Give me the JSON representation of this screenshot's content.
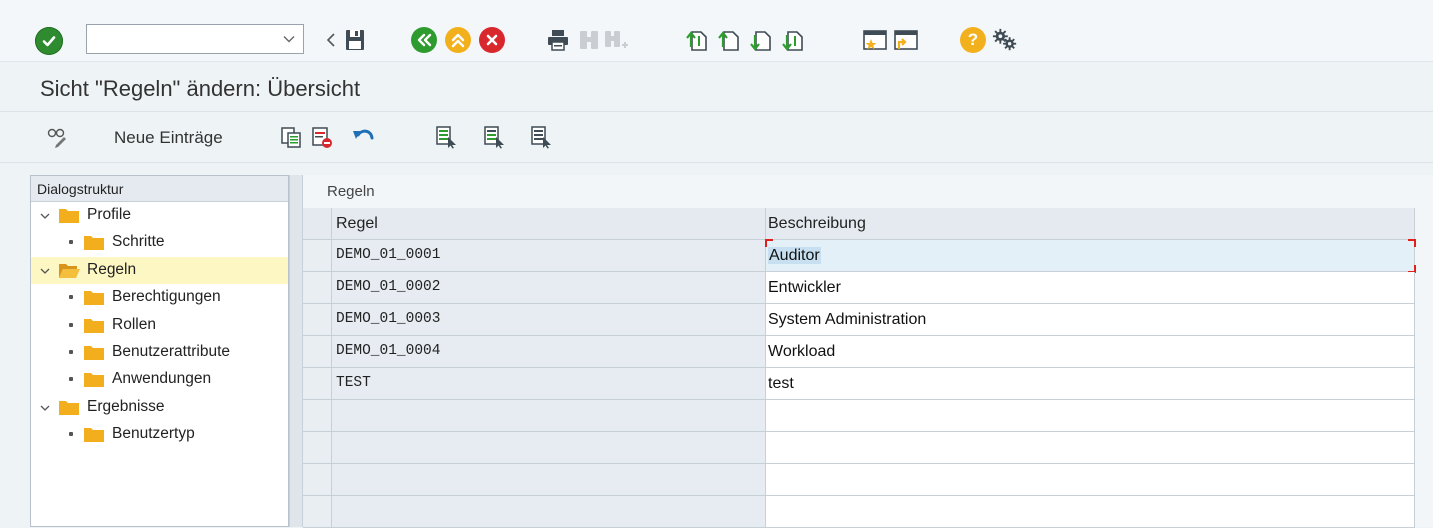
{
  "toolbar": {
    "command_value": "",
    "icons": [
      "enter-icon",
      "dropdown-icon",
      "back-arrow-icon",
      "save-icon",
      "back-icon",
      "exit-icon",
      "cancel-icon",
      "print-icon",
      "find-icon",
      "find-next-icon",
      "first-page-icon",
      "previous-page-icon",
      "next-page-icon",
      "last-page-icon",
      "create-session-icon",
      "shortcut-icon",
      "help-icon",
      "settings-icon"
    ]
  },
  "title": "Sicht \"Regeln\" ändern: Übersicht",
  "app_toolbar": {
    "new_entries_label": "Neue Einträge",
    "icons": [
      "display-change-icon",
      "copy-icon",
      "delete-icon",
      "undo-icon",
      "select-all-icon",
      "select-block-icon",
      "deselect-all-icon"
    ]
  },
  "tree": {
    "header": "Dialogstruktur",
    "items": [
      {
        "label": "Profile",
        "level": 0,
        "expanded": true
      },
      {
        "label": "Schritte",
        "level": 1
      },
      {
        "label": "Regeln",
        "level": 0,
        "expanded": true,
        "selected": true
      },
      {
        "label": "Berechtigungen",
        "level": 1
      },
      {
        "label": "Rollen",
        "level": 1
      },
      {
        "label": "Benutzerattribute",
        "level": 1
      },
      {
        "label": "Anwendungen",
        "level": 1
      },
      {
        "label": "Ergebnisse",
        "level": 0,
        "expanded": true
      },
      {
        "label": "Benutzertyp",
        "level": 1
      }
    ]
  },
  "panel": {
    "title": "Regeln",
    "columns": [
      "Regel",
      "Beschreibung"
    ],
    "rows": [
      {
        "regel": "DEMO_01_0001",
        "beschreibung": "Auditor"
      },
      {
        "regel": "DEMO_01_0002",
        "beschreibung": "Entwickler"
      },
      {
        "regel": "DEMO_01_0003",
        "beschreibung": "System Administration"
      },
      {
        "regel": "DEMO_01_0004",
        "beschreibung": "Workload"
      },
      {
        "regel": "TEST",
        "beschreibung": "test"
      }
    ]
  },
  "colors": {
    "ok_green": "#2f8b2f",
    "sap_green": "#2e9b2e",
    "yellow": "#f3b01d",
    "red": "#d9272e",
    "folder": "#f2ae1c",
    "selection": "#fdf7c4",
    "focus_corner": "#e2201b"
  }
}
